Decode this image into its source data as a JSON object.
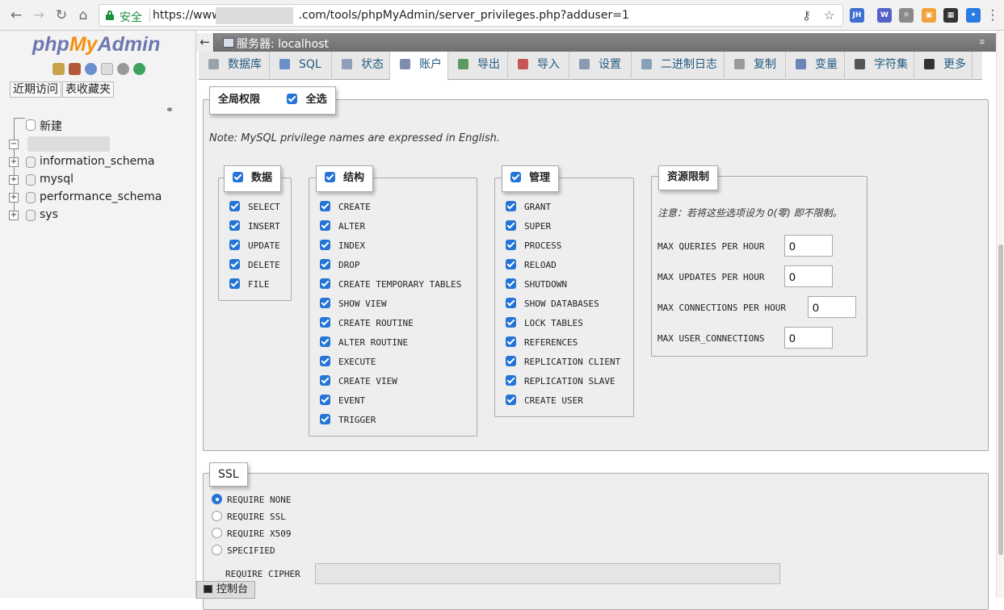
{
  "browser": {
    "secure_label": "安全",
    "url_prefix": "https://www",
    "url_suffix": ".com/tools/phpMyAdmin/server_privileges.php?adduser=1",
    "extensions": [
      {
        "name": "jh-extension-icon",
        "label": "JH",
        "color": "#3f6fd1"
      },
      {
        "name": "weibo-extension-icon",
        "label": "W",
        "color": "#5461c8"
      },
      {
        "name": "react-extension-icon",
        "label": "⚛",
        "color": "#8a8a8a"
      },
      {
        "name": "orange-extension-icon",
        "label": "▣",
        "color": "#f2a23b"
      },
      {
        "name": "qr-extension-icon",
        "label": "▦",
        "color": "#333333"
      },
      {
        "name": "blue-extension-icon",
        "label": "✦",
        "color": "#2a7be4"
      }
    ]
  },
  "sidebar": {
    "logo": {
      "php": "php",
      "my": "My",
      "admin": "Admin"
    },
    "recent_label": "近期访问",
    "favorites_label": "表收藏夹",
    "new_label": "新建",
    "databases": [
      "information_schema",
      "mysql",
      "performance_schema",
      "sys"
    ]
  },
  "topbar": {
    "server_label": "服务器: localhost"
  },
  "tabs": [
    {
      "label": "数据库",
      "icon": "database-icon",
      "color": "#9aa3aa"
    },
    {
      "label": "SQL",
      "icon": "sql-icon",
      "color": "#6b8fc8"
    },
    {
      "label": "状态",
      "icon": "status-icon",
      "color": "#8fa0b8"
    },
    {
      "label": "账户",
      "icon": "accounts-icon",
      "color": "#7d8fae"
    },
    {
      "label": "导出",
      "icon": "export-icon",
      "color": "#5d9a5d"
    },
    {
      "label": "导入",
      "icon": "import-icon",
      "color": "#c75656"
    },
    {
      "label": "设置",
      "icon": "settings-wrench-icon",
      "color": "#8a9bb0"
    },
    {
      "label": "二进制日志",
      "icon": "binlog-icon",
      "color": "#8aa0b8"
    },
    {
      "label": "复制",
      "icon": "replication-icon",
      "color": "#9a9a9a"
    },
    {
      "label": "变量",
      "icon": "variables-icon",
      "color": "#6c84b6"
    },
    {
      "label": "字符集",
      "icon": "charset-icon",
      "color": "#555555"
    },
    {
      "label": "更多",
      "icon": "chevron-down-icon",
      "color": "#333333"
    }
  ],
  "global": {
    "legend": "全局权限",
    "select_all": "全选",
    "note": "Note: MySQL privilege names are expressed in English.",
    "data": {
      "legend": "数据",
      "items": [
        "SELECT",
        "INSERT",
        "UPDATE",
        "DELETE",
        "FILE"
      ]
    },
    "structure": {
      "legend": "结构",
      "items": [
        "CREATE",
        "ALTER",
        "INDEX",
        "DROP",
        "CREATE TEMPORARY TABLES",
        "SHOW VIEW",
        "CREATE ROUTINE",
        "ALTER ROUTINE",
        "EXECUTE",
        "CREATE VIEW",
        "EVENT",
        "TRIGGER"
      ]
    },
    "admin": {
      "legend": "管理",
      "items": [
        "GRANT",
        "SUPER",
        "PROCESS",
        "RELOAD",
        "SHUTDOWN",
        "SHOW DATABASES",
        "LOCK TABLES",
        "REFERENCES",
        "REPLICATION CLIENT",
        "REPLICATION SLAVE",
        "CREATE USER"
      ]
    },
    "resources": {
      "legend": "资源限制",
      "note": "注意：若将这些选项设为 0(零) 即不限制。",
      "rows": [
        {
          "label": "MAX QUERIES PER HOUR",
          "value": "0"
        },
        {
          "label": "MAX UPDATES PER HOUR",
          "value": "0"
        },
        {
          "label": "MAX CONNECTIONS PER HOUR",
          "value": "0"
        },
        {
          "label": "MAX USER_CONNECTIONS",
          "value": "0"
        }
      ]
    }
  },
  "ssl": {
    "legend": "SSL",
    "options": [
      {
        "label": "REQUIRE NONE",
        "selected": true
      },
      {
        "label": "REQUIRE SSL",
        "selected": false
      },
      {
        "label": "REQUIRE X509",
        "selected": false
      },
      {
        "label": "SPECIFIED",
        "selected": false
      }
    ],
    "cipher_label": "REQUIRE CIPHER"
  },
  "console_label": "控制台"
}
